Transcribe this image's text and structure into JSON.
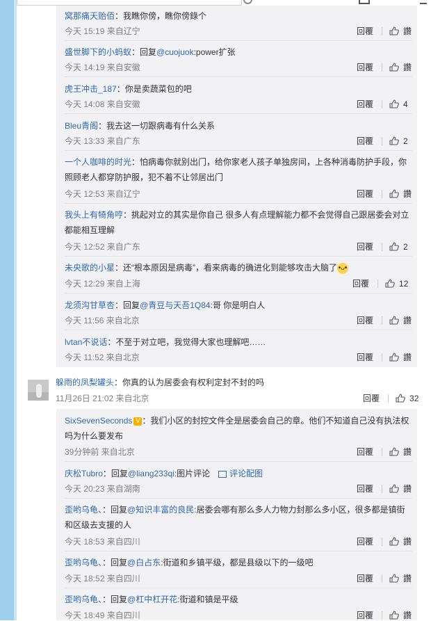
{
  "topbar": {
    "search_icon": "search-icon",
    "icon2": "inbox-icon",
    "icon3": "minimize-icon"
  },
  "labels": {
    "reply": "回覆",
    "like": "讚",
    "img_comment": "评论配图"
  },
  "replies_a": [
    {
      "user": "窝那痛天贻佰",
      "text": "：我瞧你傍，瞧你傍錄个",
      "time": "今天 15:19 来自辽宁",
      "likes": "讚"
    },
    {
      "user": "盛世脚下的小蚂蚁",
      "text": "：回复",
      "mention": "@cuojuok",
      "text2": ":power扩张",
      "time": "今天 14:19 来自安徽",
      "likes": "讚"
    },
    {
      "user": "虎王冲击_187",
      "text": "：你是卖蔬菜包的吧",
      "time": "今天 14:08 来自安徽",
      "likes": "4"
    },
    {
      "user": "Bleu青阁",
      "text": "：我去这一切跟病毒有什么关系",
      "time": "今天 13:33 来自广东",
      "likes": "2"
    },
    {
      "user": "一个人咖啡的时光",
      "text": "：怕病毒你就别出门，给你家老人孩子单独房间，上各种消毒防护手段，你照顾老人都穿防护服，犯不着不让邻居出门",
      "time": "今天 12:53 来自辽宁",
      "likes": "讚"
    },
    {
      "user": "我头上有犄角哼",
      "text": "：挑起对立的其实是你自己 很多人有点理解能力都不会觉得自己跟居委会对立 都能相互理解",
      "time": "今天 12:52 来自广东",
      "likes": "2"
    },
    {
      "user": "未央歌的小星",
      "text": "：还“根本原因是病毒”，看来病毒的确进化到能够攻击大脑了",
      "time": "今天 12:29 来自上海",
      "likes": "12"
    },
    {
      "user": "龙须沟甘草杏",
      "text": "：回复",
      "mention": "@青豆与天吾1Q84",
      "text2": ":哥 你是明白人",
      "time": "今天 11:56 来自北京",
      "likes": "讚"
    },
    {
      "user": "lvtan不说话",
      "text": "：不至于对立吧，我觉得大家也理解吧……",
      "time": "今天 11:52 来自北京",
      "likes": "讚"
    }
  ],
  "main": {
    "user": "躲雨的凤梨罐头",
    "text": "：你真的认为居委会有权利定封不封的吗",
    "time": "11月26日 21:02 来自北京",
    "likes": "32"
  },
  "replies_b": [
    {
      "user": "SixSevenSeconds",
      "text": "：我们小区的封控文件全是居委会自己的章。他们不知道自己没有执法权吗为什么要发布",
      "time": "39分钟前 来自北京",
      "likes": "讚"
    },
    {
      "user": "庆松Tubro",
      "text": "：回复",
      "mention": "@liang233qi",
      "text2": ":图片评论",
      "time": "今天 20:23 来自湖南",
      "likes": "讚"
    },
    {
      "user": "歪哟乌龟、",
      "text": "：回复",
      "mention": "@知识丰富的良民",
      "text2": ":居委会哪有那么多人力物力封那么多小区，很多都是镇街和区级去支援的人",
      "time": "今天 18:53 来自四川",
      "likes": "讚"
    },
    {
      "user": "歪哟乌龟、",
      "text": "：回复",
      "mention": "@白占东",
      "text2": ":街道和乡镇平级，都是县级以下的一级吧",
      "time": "今天 18:52 来自四川",
      "likes": "讚"
    },
    {
      "user": "歪哟乌龟、",
      "text": "：回复",
      "mention": "@杠中杠开花",
      "text2": ":街道和镇是平级",
      "time": "今天 18:49 来自四川",
      "likes": "讚"
    }
  ]
}
